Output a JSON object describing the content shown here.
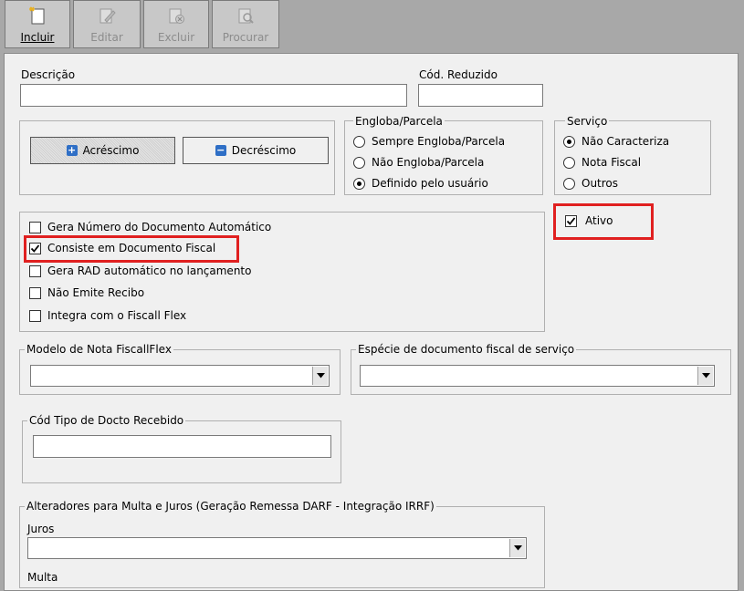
{
  "toolbar": {
    "incluir": "Incluir",
    "editar": "Editar",
    "excluir": "Excluir",
    "procurar": "Procurar"
  },
  "form": {
    "descricao_label": "Descrição",
    "descricao_value": "",
    "cod_reduzido_label": "Cód. Reduzido",
    "cod_reduzido_value": "",
    "acrescimo_label": "Acréscimo",
    "decrescimo_label": "Decréscimo",
    "engloba": {
      "title": "Engloba/Parcela",
      "options": [
        "Sempre Engloba/Parcela",
        "Não Engloba/Parcela",
        "Definido pelo usuário"
      ],
      "selected": "Definido pelo usuário"
    },
    "servico": {
      "title": "Serviço",
      "options": [
        "Não Caracteriza",
        "Nota Fiscal",
        "Outros"
      ],
      "selected": "Não Caracteriza"
    },
    "ativo_label": "Ativo",
    "ativo_checked": true,
    "checks": [
      {
        "label": "Gera Número do Documento Automático",
        "checked": false
      },
      {
        "label": "Consiste em Documento Fiscal",
        "checked": true
      },
      {
        "label": "Gera RAD automático no lançamento",
        "checked": false
      },
      {
        "label": "Não Emite Recibo",
        "checked": false
      },
      {
        "label": "Integra com o Fiscall Flex",
        "checked": false
      }
    ],
    "modelo_label": "Modelo de Nota FiscallFlex",
    "modelo_value": "",
    "especie_label": "Espécie de documento fiscal de serviço",
    "especie_value": "",
    "cod_tipo_label": "Cód Tipo de Docto Recebido",
    "cod_tipo_value": "",
    "alteradores_label": "Alteradores para Multa e Juros (Geração Remessa DARF - Integração IRRF)",
    "juros_label": "Juros",
    "juros_value": "",
    "multa_label": "Multa"
  },
  "colors": {
    "highlight": "#e02020",
    "accent_blue": "#2f6fc6"
  }
}
